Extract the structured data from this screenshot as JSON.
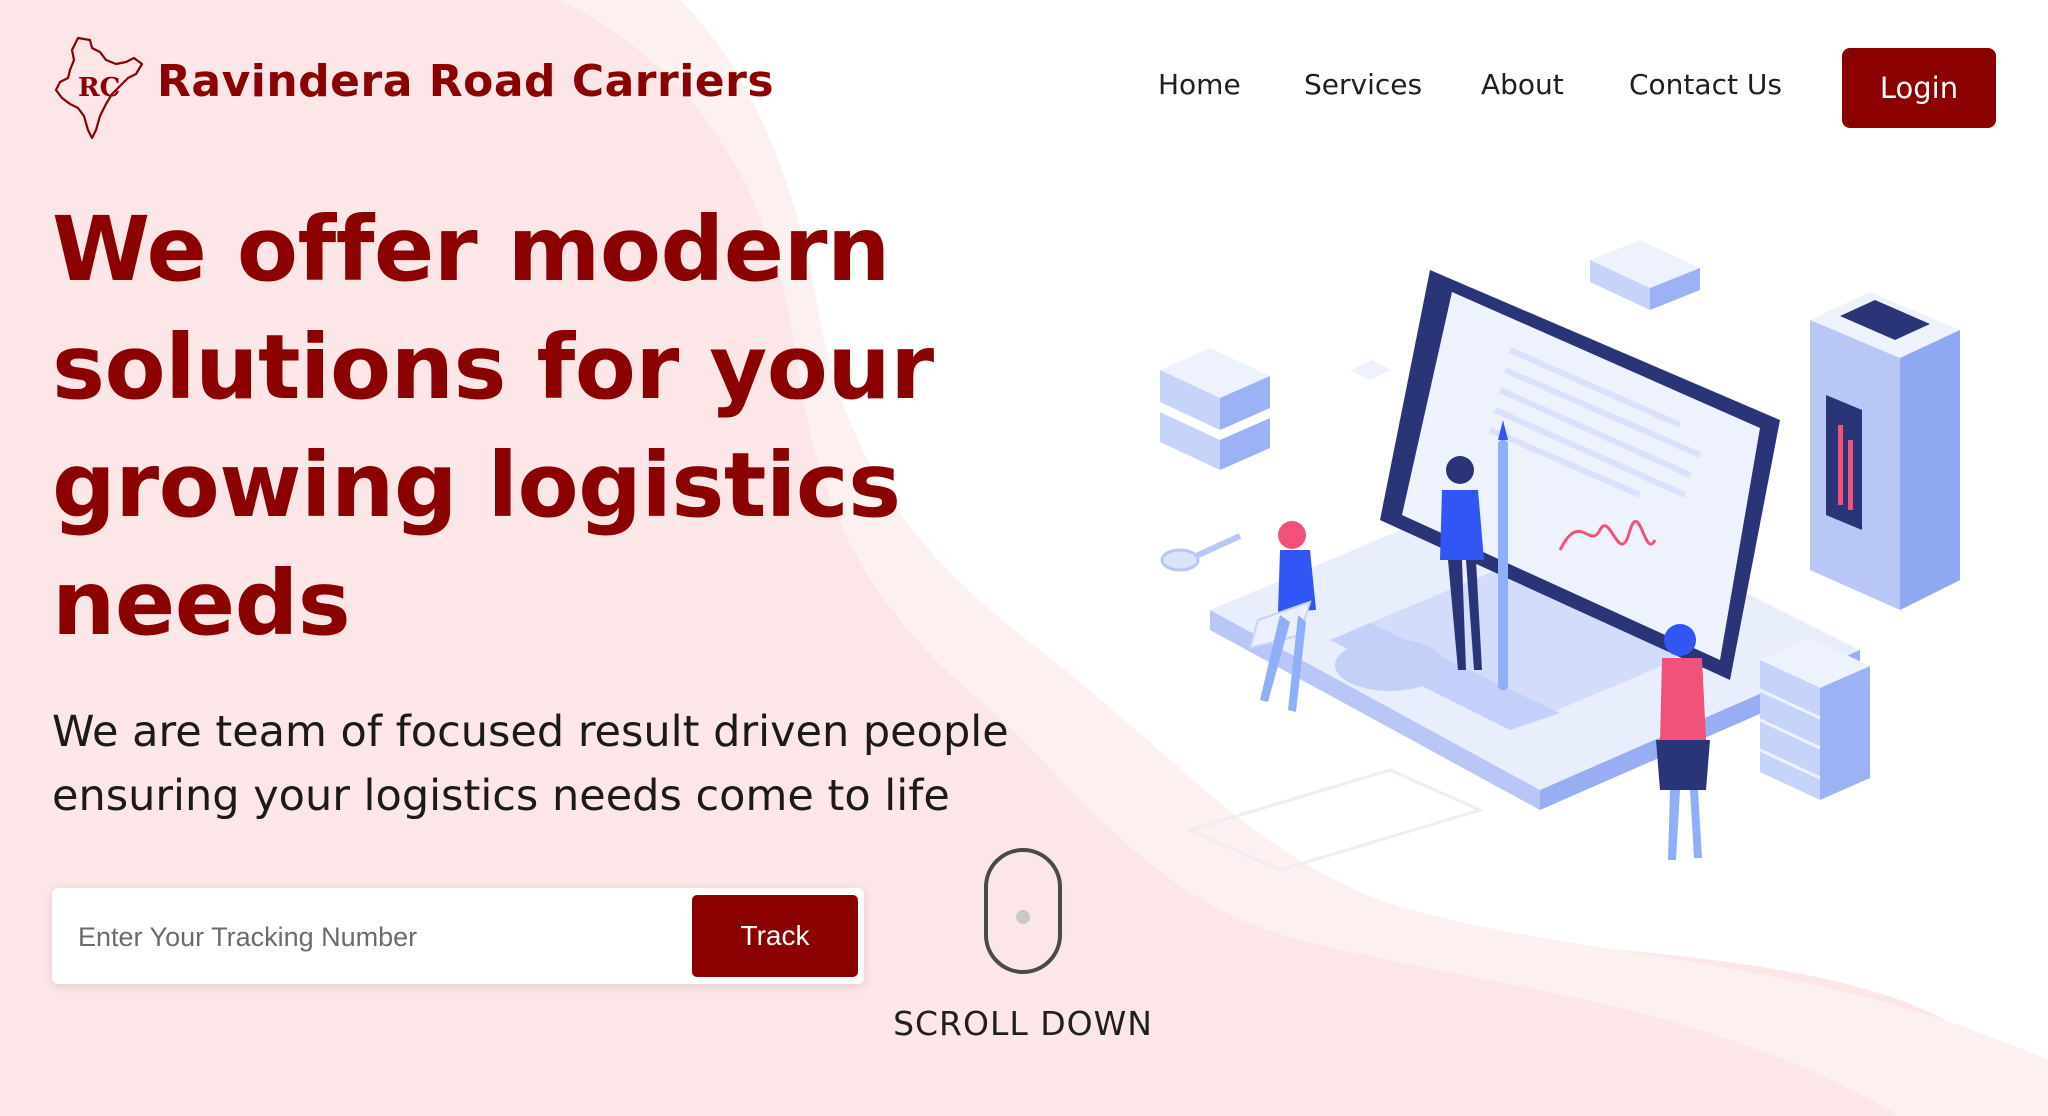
{
  "brand": {
    "name": "Ravindera Road Carriers",
    "logo_text": "RC"
  },
  "nav": {
    "items": [
      {
        "label": "Home"
      },
      {
        "label": "Services"
      },
      {
        "label": "About"
      },
      {
        "label": "Contact Us"
      }
    ],
    "login_label": "Login"
  },
  "hero": {
    "title": "We offer modern solutions for your growing logistics needs",
    "subtitle": "We are team of focused result driven people ensuring your logistics needs come to life"
  },
  "tracking": {
    "placeholder": "Enter Your Tracking Number",
    "button_label": "Track"
  },
  "scroll": {
    "label": "SCROLL DOWN"
  },
  "colors": {
    "primary": "#8b0000",
    "background_wave": "#fde8e8",
    "illustration_blue": "#7f9cf5",
    "illustration_navy": "#2a3577",
    "illustration_pink": "#f0527a"
  },
  "icons": [
    "india-map-logo-icon",
    "mouse-scroll-icon"
  ]
}
